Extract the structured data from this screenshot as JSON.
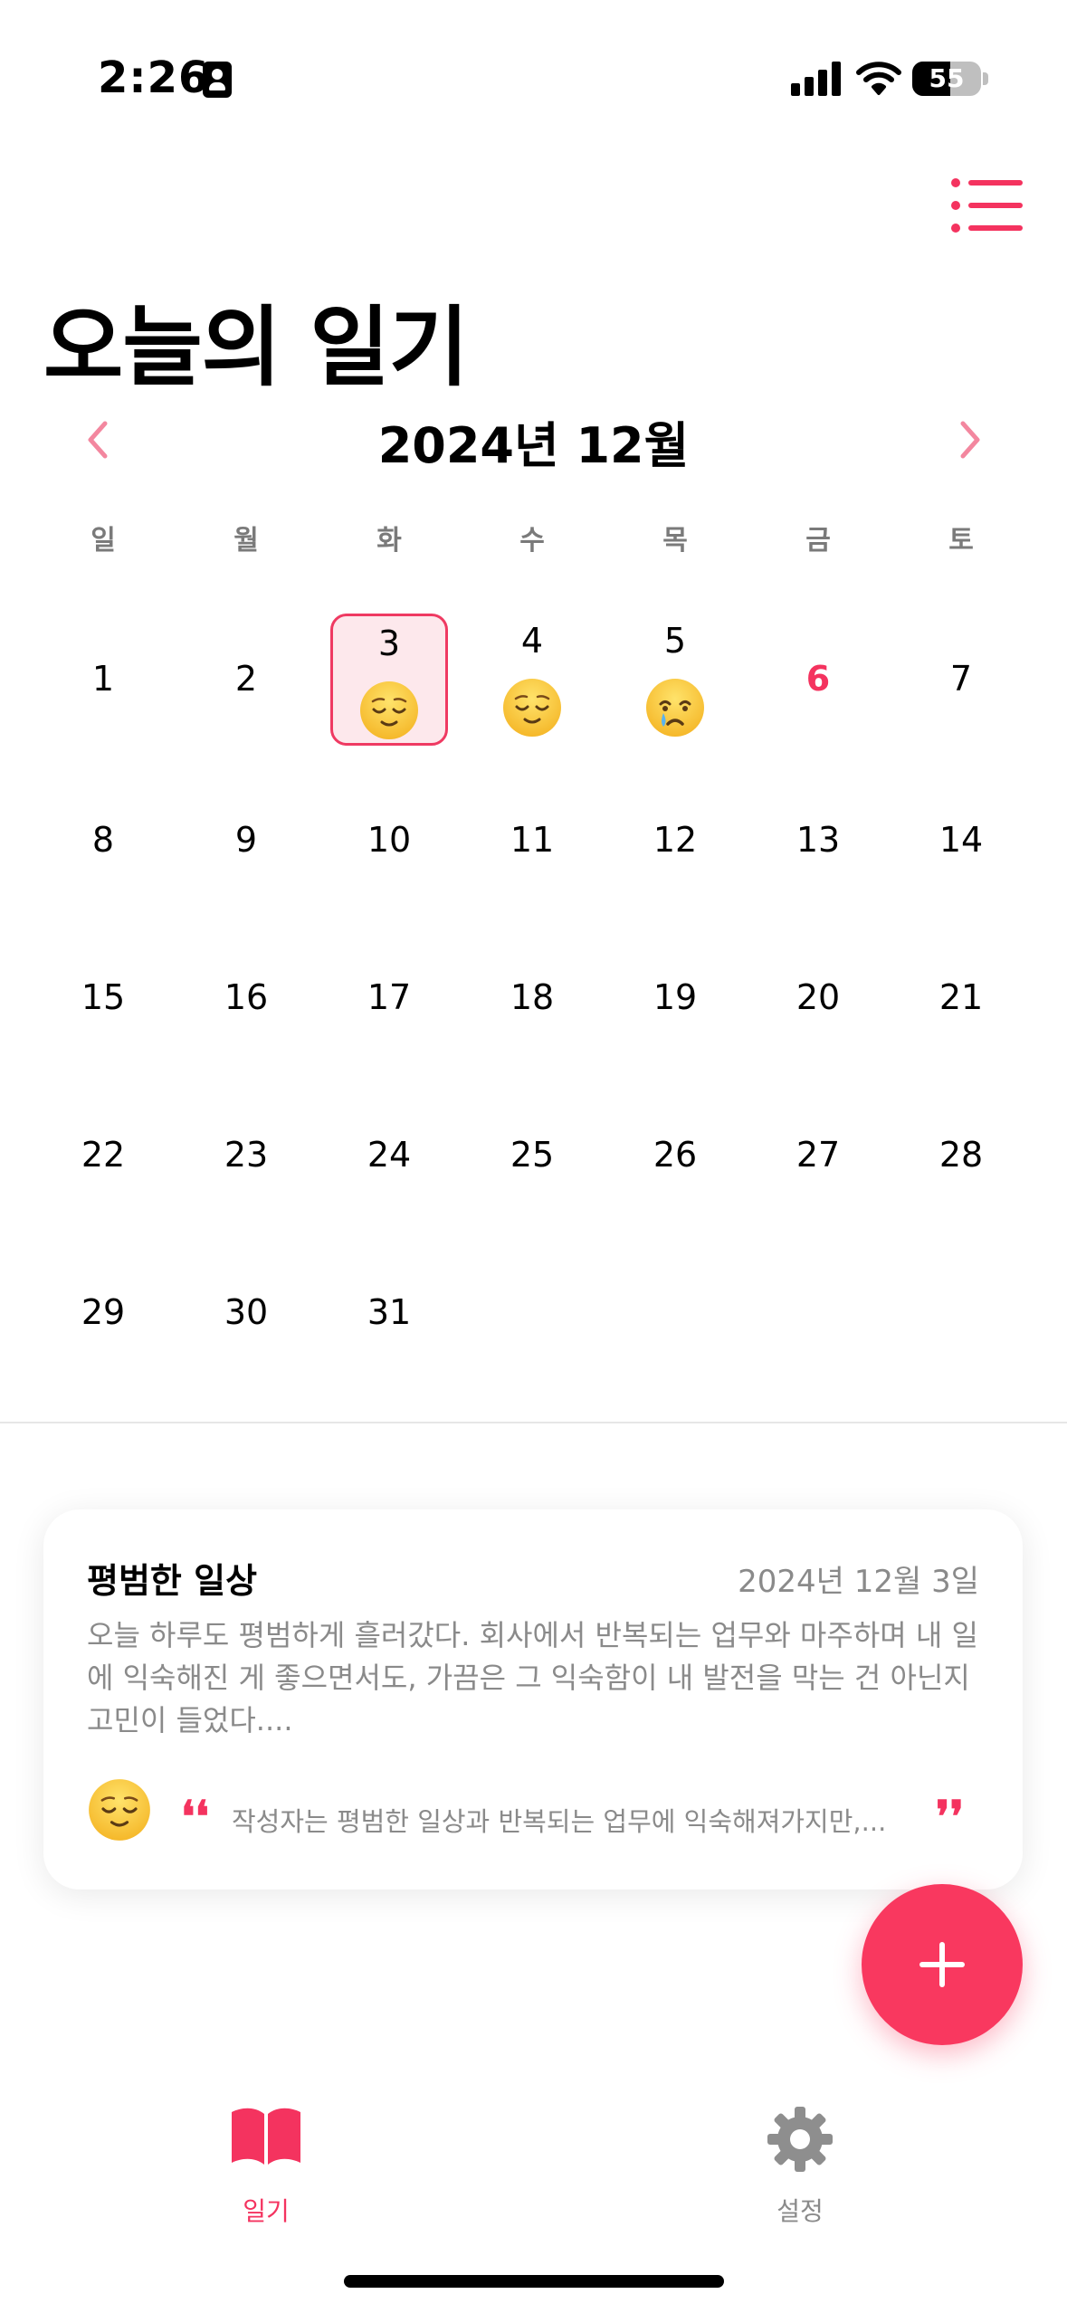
{
  "status_bar": {
    "time": "2:26",
    "battery": "55",
    "battery_level": 0.55
  },
  "header": {
    "title": "오늘의 일기"
  },
  "calendar": {
    "month_label": "2024년 12월",
    "weekdays": [
      "일",
      "월",
      "화",
      "수",
      "목",
      "금",
      "토"
    ],
    "days": [
      {
        "day": "1"
      },
      {
        "day": "2"
      },
      {
        "day": "3",
        "emoji": "relieved-face",
        "selected": true
      },
      {
        "day": "4",
        "emoji": "relieved-face"
      },
      {
        "day": "5",
        "emoji": "crying-face"
      },
      {
        "day": "6",
        "today": true
      },
      {
        "day": "7"
      },
      {
        "day": "8"
      },
      {
        "day": "9"
      },
      {
        "day": "10"
      },
      {
        "day": "11"
      },
      {
        "day": "12"
      },
      {
        "day": "13"
      },
      {
        "day": "14"
      },
      {
        "day": "15"
      },
      {
        "day": "16"
      },
      {
        "day": "17"
      },
      {
        "day": "18"
      },
      {
        "day": "19"
      },
      {
        "day": "20"
      },
      {
        "day": "21"
      },
      {
        "day": "22"
      },
      {
        "day": "23"
      },
      {
        "day": "24"
      },
      {
        "day": "25"
      },
      {
        "day": "26"
      },
      {
        "day": "27"
      },
      {
        "day": "28"
      },
      {
        "day": "29"
      },
      {
        "day": "30"
      },
      {
        "day": "31"
      }
    ]
  },
  "entry": {
    "title": "평범한 일상",
    "date": "2024년 12월 3일",
    "body": "오늘 하루도 평범하게 흘러갔다. 회사에서 반복되는 업무와 마주하며 내 일에 익숙해진 게 좋으면서도, 가끔은 그 익숙함이 내 발전을 막는 건 아닌지 고민이 들었다....",
    "emoji": "relieved-face",
    "summary": "작성자는 평범한 일상과 반복되는 업무에 익숙해져가지만,...",
    "quote_open": "❛❛",
    "quote_close": "❜❜"
  },
  "tab_bar": {
    "diary_label": "일기",
    "settings_label": "설정"
  },
  "colors": {
    "accent": "#f4335f",
    "selected_bg": "#fde8ec",
    "muted": "#8a8a8a"
  }
}
